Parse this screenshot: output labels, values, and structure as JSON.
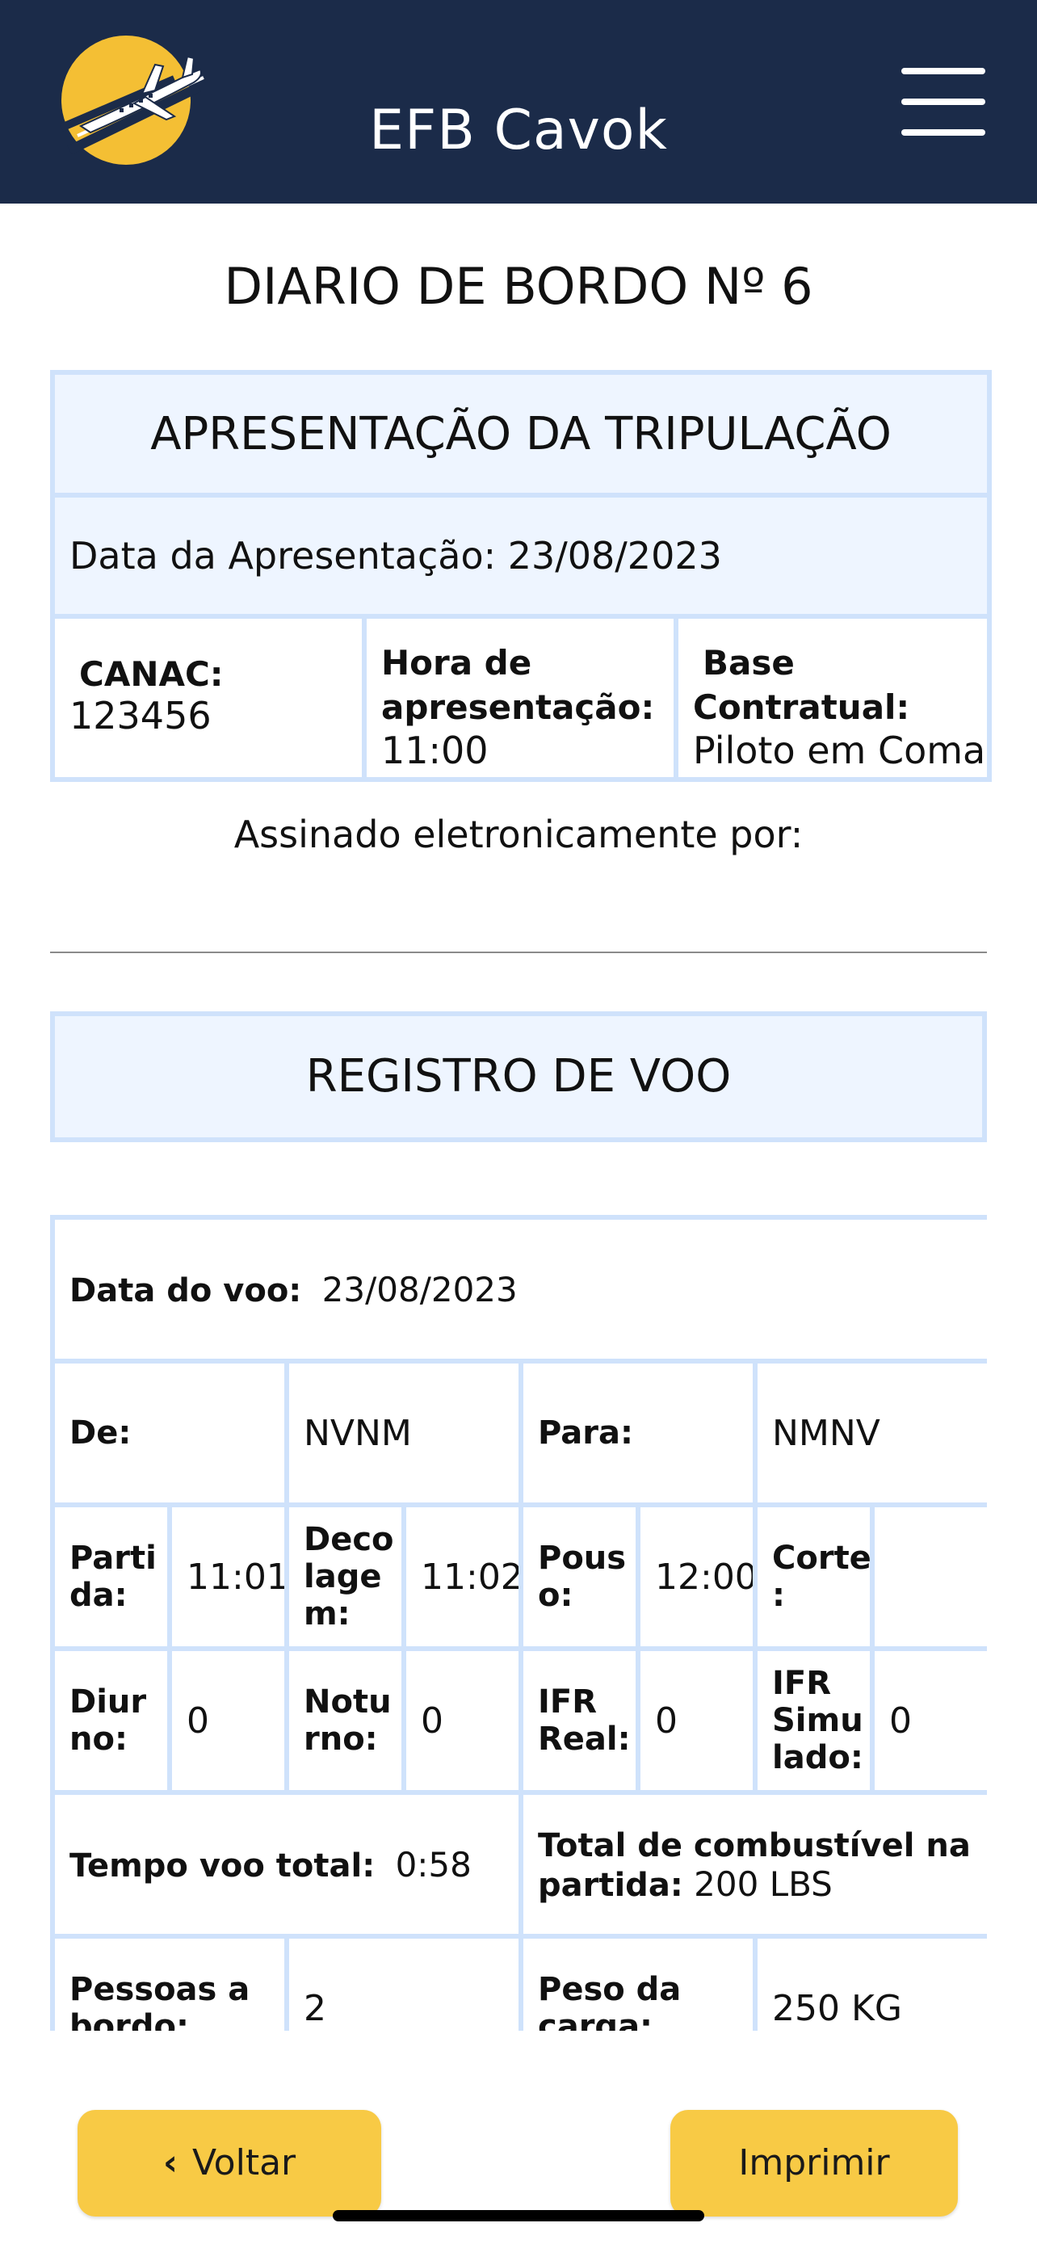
{
  "header": {
    "title": "EFB Cavok"
  },
  "page": {
    "title": "DIARIO DE BORDO Nº 6"
  },
  "apresentacao": {
    "title": "APRESENTAÇÃO DA TRIPULAÇÃO",
    "date_label": "Data da Apresentação:",
    "date_value": "23/08/2023",
    "canac_label": "CANAC:",
    "canac_value": "123456",
    "hora_label_1": "Hora de",
    "hora_label_2": "apresentação:",
    "hora_value": "11:00",
    "base_label_1": "Base",
    "base_label_2": "Contratual:",
    "base_value": "Piloto em Comando"
  },
  "signed": {
    "text": "Assinado eletronicamente por:"
  },
  "registro": {
    "title": "REGISTRO DE VOO",
    "data_voo_label": "Data do voo:",
    "data_voo_value": "23/08/2023",
    "de_label": "De:",
    "de_value": "NVNM",
    "para_label": "Para:",
    "para_value": "NMNV",
    "partida_label": "Parti da:",
    "partida_value": "11:01",
    "decolagem_label": "Deco lage m:",
    "decolagem_value": "11:02",
    "pouso_label": "Pous o:",
    "pouso_value": "12:00",
    "corte_label": "Corte :",
    "corte_value": "",
    "diurno_label": "Diur no:",
    "diurno_value": "0",
    "noturno_label": "Notu rno:",
    "noturno_value": "0",
    "ifr_real_label": "IFR Real:",
    "ifr_real_value": "0",
    "ifr_simulado_label": "IFR Simu lado:",
    "ifr_simulado_value": "0",
    "tempo_total_label": "Tempo voo total:",
    "tempo_total_value": "0:58",
    "combustivel_label": "Total de combustível na partida:",
    "combustivel_value": "200 LBS",
    "pessoas_label": "Pessoas a bordo:",
    "pessoas_value": "2",
    "peso_label": "Peso da carga:",
    "peso_value": "250 KG"
  },
  "buttons": {
    "voltar": "Voltar",
    "imprimir": "Imprimir"
  },
  "icons": {
    "logo": "plane-logo",
    "menu": "hamburger-menu-icon",
    "back": "chevron-left-icon"
  },
  "colors": {
    "header_bg": "#1b2b49",
    "accent_yellow": "#f8ca45",
    "cell_border": "#cfe2fb",
    "cell_fill": "#eef5ff"
  }
}
